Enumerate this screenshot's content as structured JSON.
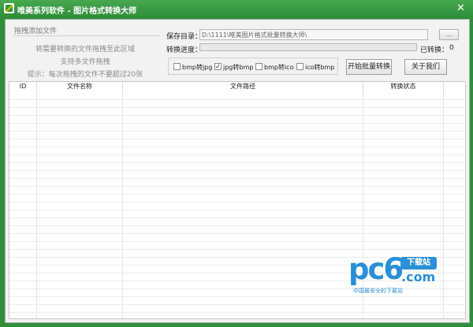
{
  "window": {
    "title": "唯美系列软件 - 图片格式转换大师",
    "close_glyph": "✕",
    "accent_color": "#2f8e3a"
  },
  "drop_panel": {
    "title": "拖拽添加文件",
    "line1": "将需要转换的文件拖拽至此区域",
    "line2": "支持多文件拖拽",
    "line3": "提示：每次拖拽的文件不要超过20张"
  },
  "settings": {
    "save_dir_label": "保存目录：",
    "save_dir_value": "D:\\1111\\唯美图片格式批量转换大师\\",
    "browse_label": "...",
    "progress_label": "转换进度：",
    "progress_value": 0,
    "converted_label": "已转换：",
    "converted_count": "0"
  },
  "formats": [
    {
      "label": "bmp转jpg",
      "checked": false
    },
    {
      "label": "jpg转bmp",
      "checked": true
    },
    {
      "label": "bmp转ico",
      "checked": false
    },
    {
      "label": "ico转bmp",
      "checked": false
    }
  ],
  "buttons": {
    "start": "开始批量转换",
    "about": "关于我们"
  },
  "table": {
    "columns": [
      "ID",
      "文件名称",
      "文件路径",
      "转换状态"
    ]
  },
  "watermark": {
    "logo": "pc6",
    "badge": "下载站",
    "domain": ".com",
    "tagline": "中国最安全的下载站"
  }
}
